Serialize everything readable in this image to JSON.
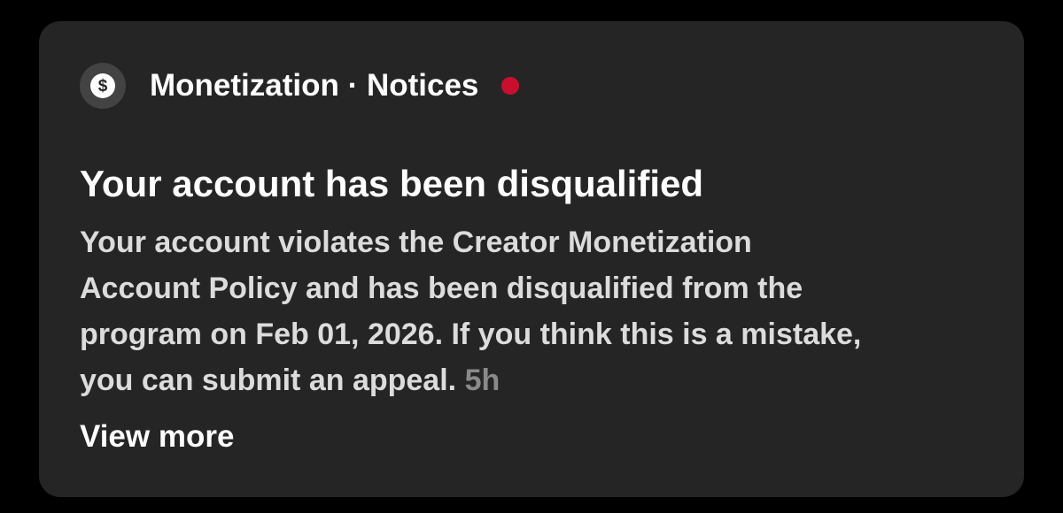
{
  "notification": {
    "category": "Monetization · Notices",
    "icon": "dollar-sign-icon",
    "unread": true,
    "title": "Your account has been disqualified",
    "body_lines": [
      "Your account violates the Creator Monetization",
      "Account Policy and has been disqualified from the",
      "program on Feb 01, 2026. If you think this is a mistake,",
      "you can submit an appeal."
    ],
    "timestamp": "5h",
    "view_more_label": "View more",
    "icon_glyph": "$"
  },
  "colors": {
    "page_background": "#000000",
    "card_background": "#252525",
    "unread_dot": "#c8102e",
    "timestamp": "#8a8a8a"
  }
}
